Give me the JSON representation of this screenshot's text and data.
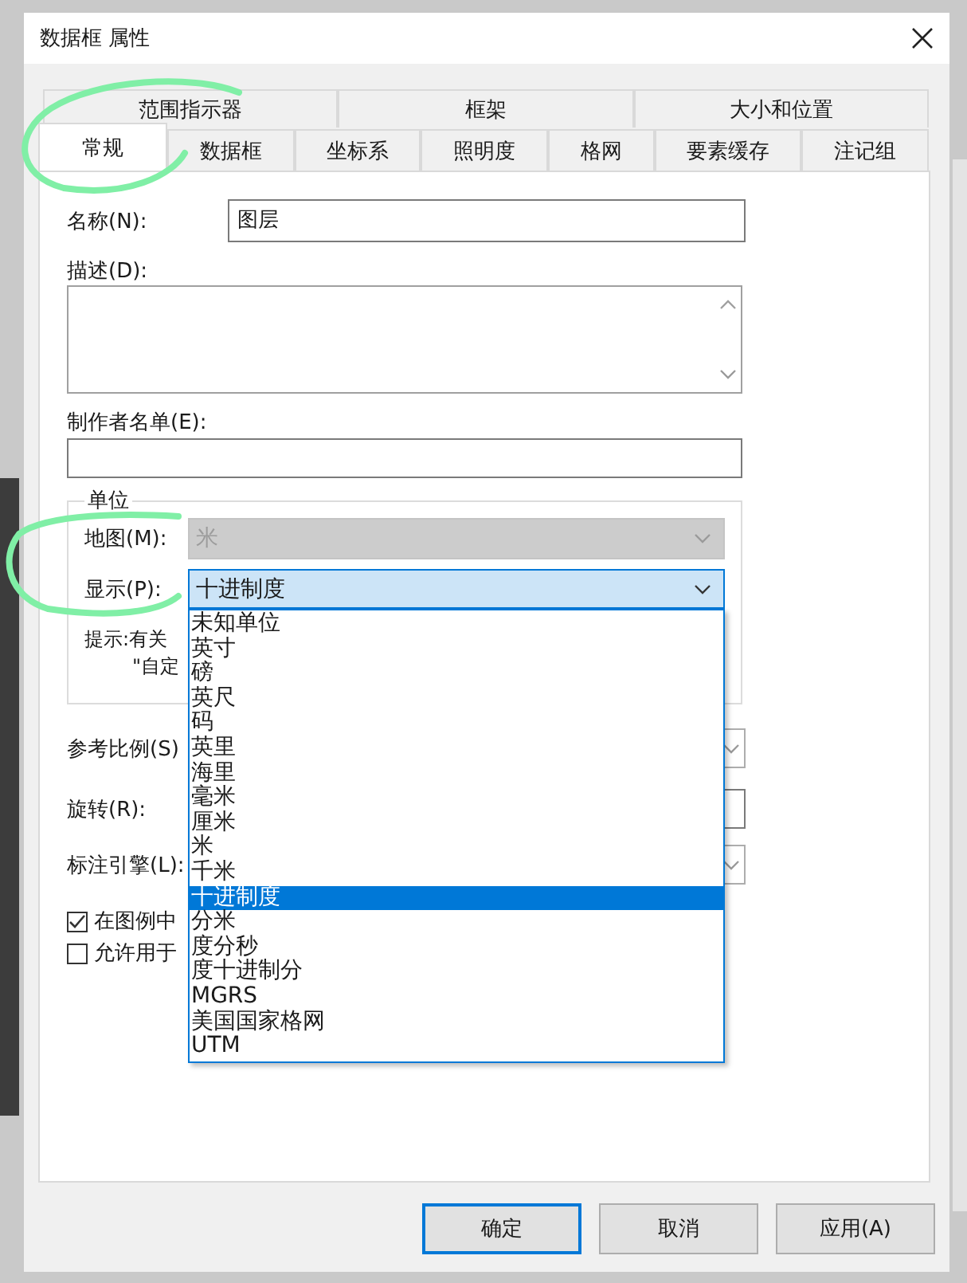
{
  "window": {
    "title": "数据框 属性"
  },
  "tab_rows": [
    [
      {
        "label": "范围指示器",
        "selected": false
      },
      {
        "label": "框架",
        "selected": false
      },
      {
        "label": "大小和位置",
        "selected": false
      }
    ],
    [
      {
        "label": "常规",
        "selected": true
      },
      {
        "label": "数据框",
        "selected": false
      },
      {
        "label": "坐标系",
        "selected": false
      },
      {
        "label": "照明度",
        "selected": false
      },
      {
        "label": "格网",
        "selected": false
      },
      {
        "label": "要素缓存",
        "selected": false
      },
      {
        "label": "注记组",
        "selected": false
      }
    ]
  ],
  "general": {
    "name": {
      "label": "名称(N):",
      "value": "图层"
    },
    "description": {
      "label": "描述(D):"
    },
    "credits": {
      "label": "制作者名单(E):"
    },
    "units": {
      "title": "单位",
      "map": {
        "label": "地图(M):",
        "value": "米",
        "disabled": true
      },
      "display": {
        "label": "显示(P):",
        "value": "十进制度",
        "expanded": true,
        "options": [
          {
            "label": "未知单位",
            "selected": false
          },
          {
            "label": "英寸",
            "selected": false
          },
          {
            "label": "磅",
            "selected": false
          },
          {
            "label": "英尺",
            "selected": false
          },
          {
            "label": "码",
            "selected": false
          },
          {
            "label": "英里",
            "selected": false
          },
          {
            "label": "海里",
            "selected": false
          },
          {
            "label": "毫米",
            "selected": false
          },
          {
            "label": "厘米",
            "selected": false
          },
          {
            "label": "米",
            "selected": false
          },
          {
            "label": "千米",
            "selected": false
          },
          {
            "label": "十进制度",
            "selected": true
          },
          {
            "label": "分米",
            "selected": false
          },
          {
            "label": "度分秒",
            "selected": false
          },
          {
            "label": "度十进制分",
            "selected": false
          },
          {
            "label": "MGRS",
            "selected": false
          },
          {
            "label": "美国国家格网",
            "selected": false
          },
          {
            "label": "UTM",
            "selected": false
          }
        ]
      },
      "hint": {
        "label": "提示:",
        "lines": [
          "有关",
          "\"自定"
        ]
      }
    },
    "reference_scale": {
      "label": "参考比例(S)"
    },
    "rotation": {
      "label": "旋转(R):"
    },
    "label_engine": {
      "label": "标注引擎(L):"
    },
    "checkboxes": [
      {
        "label": "在图例中",
        "checked": true
      },
      {
        "label": "允许用于",
        "checked": false
      }
    ]
  },
  "buttons": [
    {
      "label": "确定",
      "default": true
    },
    {
      "label": "取消",
      "default": false
    },
    {
      "label": "应用(A)",
      "default": false
    }
  ]
}
